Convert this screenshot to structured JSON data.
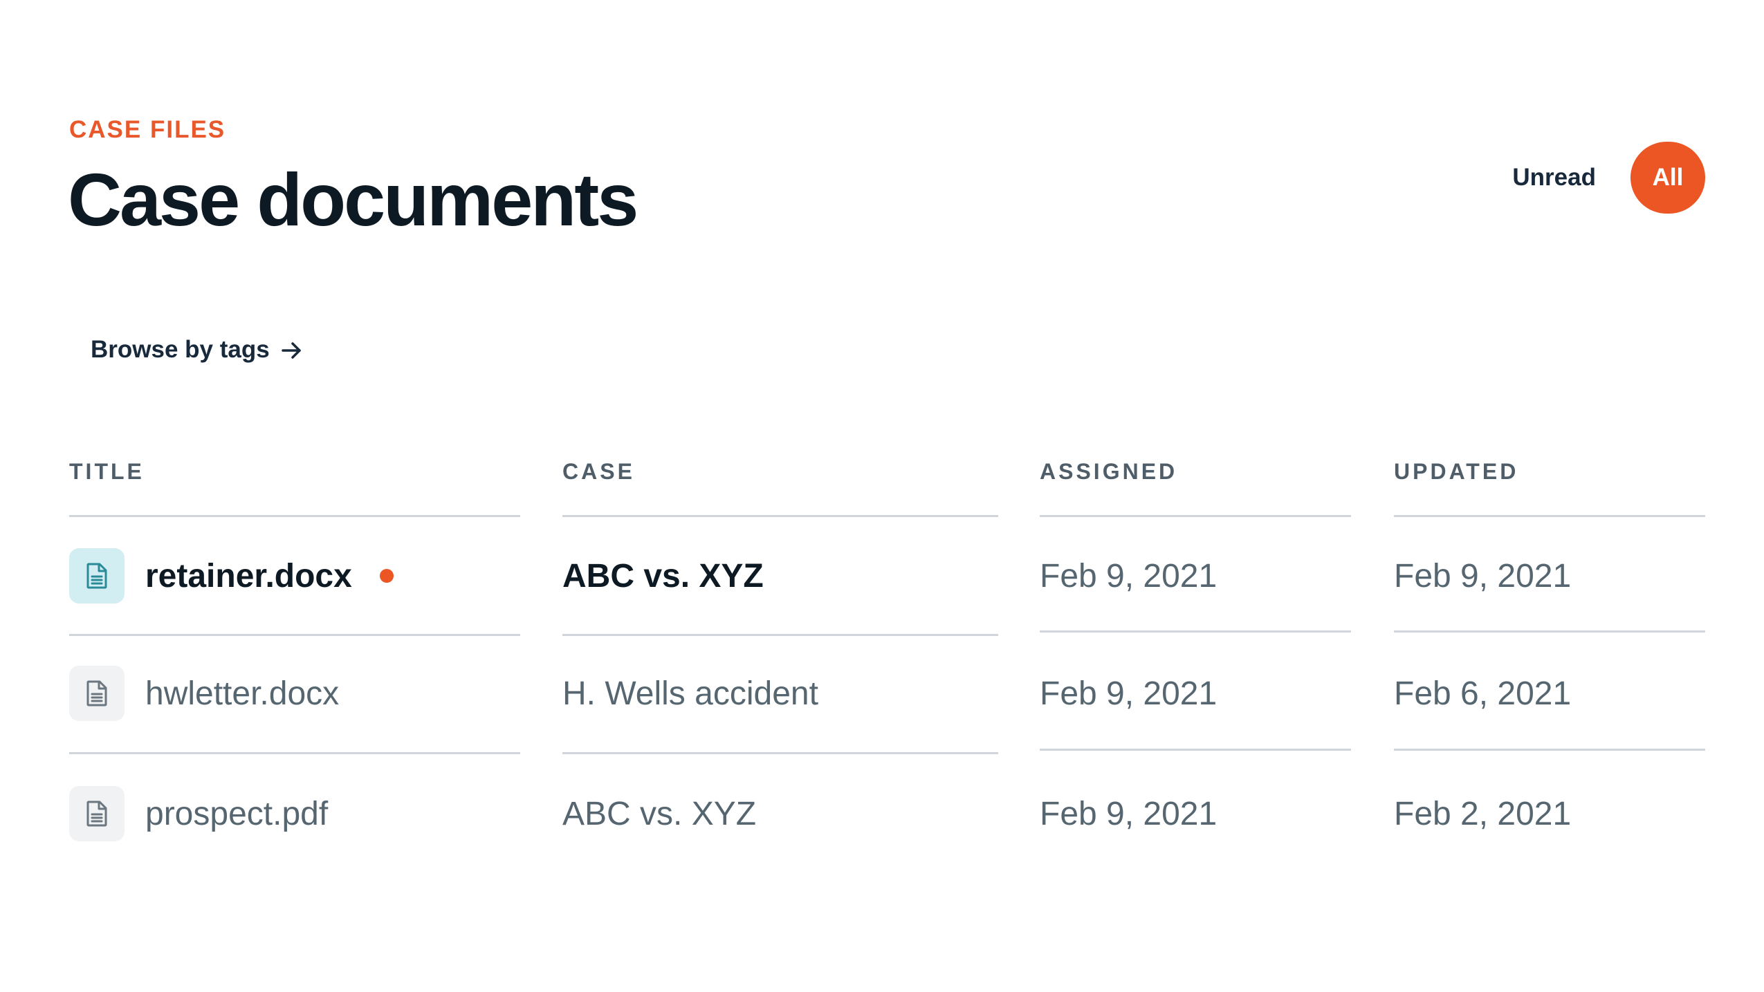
{
  "header": {
    "eyebrow": "CASE FILES",
    "title": "Case documents"
  },
  "filters": {
    "unread_label": "Unread",
    "all_label": "All",
    "active": "All"
  },
  "browse": {
    "label": "Browse by tags",
    "icon": "arrow-right-icon"
  },
  "table": {
    "columns": [
      "TITLE",
      "CASE",
      "ASSIGNED",
      "UPDATED"
    ],
    "rows": [
      {
        "title": "retainer.docx",
        "case": "ABC vs. XYZ",
        "assigned": "Feb 9, 2021",
        "updated": "Feb 9, 2021",
        "unread": true,
        "icon": "document-icon"
      },
      {
        "title": "hwletter.docx",
        "case": "H. Wells accident",
        "assigned": "Feb 9, 2021",
        "updated": "Feb 6, 2021",
        "unread": false,
        "icon": "document-icon"
      },
      {
        "title": "prospect.pdf",
        "case": "ABC vs. XYZ",
        "assigned": "Feb 9, 2021",
        "updated": "Feb 2, 2021",
        "unread": false,
        "icon": "document-icon"
      }
    ]
  },
  "colors": {
    "accent": "#ec5624",
    "eyebrow": "#e8582b",
    "heading": "#0d1a24",
    "muted_text": "#566670",
    "divider": "#cfd5da",
    "active_icon_bg": "#d3eef2",
    "active_icon_fg": "#2a8a9a",
    "icon_bg": "#f0f2f3",
    "icon_fg": "#6b7780"
  }
}
